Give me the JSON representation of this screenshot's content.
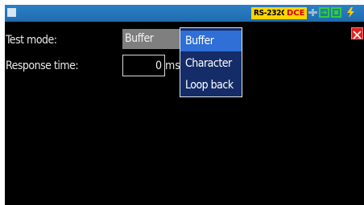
{
  "status_bar": {
    "interface_badge": "RS-232C",
    "role_badge": "DCE",
    "icons": [
      "window-icon",
      "lan-icon",
      "usb-icon",
      "sd-card-icon",
      "power-icon"
    ]
  },
  "form": {
    "test_mode_label": "Test mode:",
    "test_mode_value": "Buffer",
    "response_time_label": "Response time:",
    "response_time_value": "0",
    "response_time_unit": "ms"
  },
  "dropdown": {
    "options": [
      "Buffer",
      "Character",
      "Loop back"
    ],
    "selected_index": 0
  },
  "colors": {
    "titlebar": "#1f6cb0",
    "badge_bg": "#ffd400",
    "role_text": "#d00000",
    "status_green": "#2fd02f",
    "dropdown_bg": "#142c68",
    "dropdown_selected": "#2f6fd6",
    "close_button": "#e02020"
  }
}
